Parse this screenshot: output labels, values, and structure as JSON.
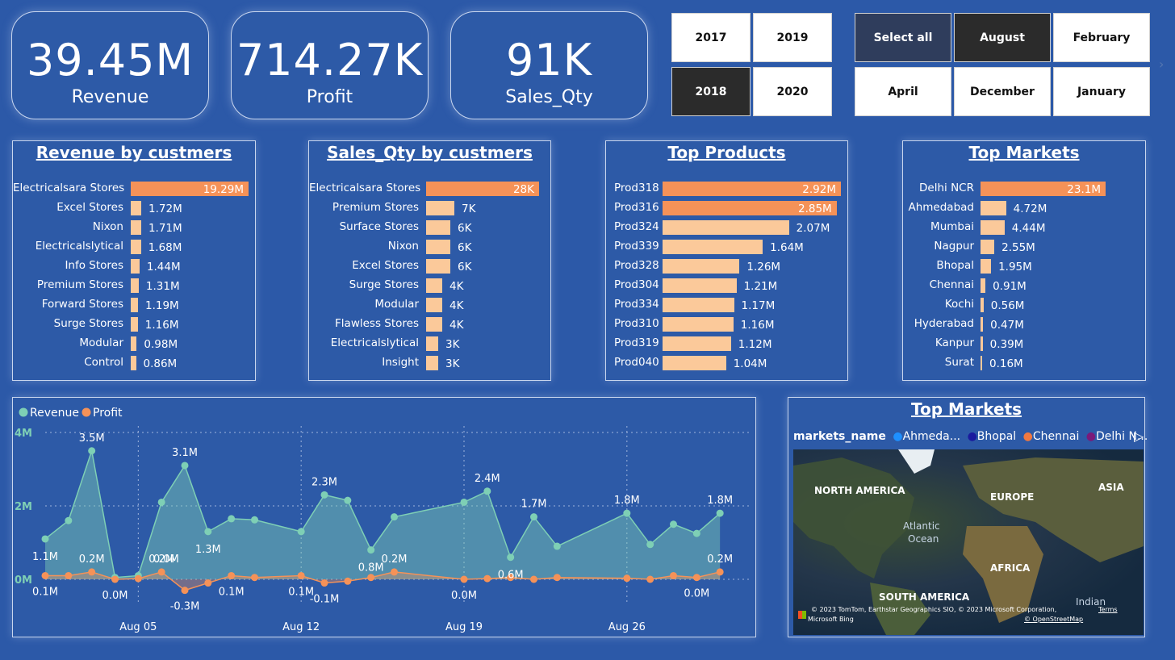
{
  "kpis": [
    {
      "value": "39.45M",
      "label": "Revenue"
    },
    {
      "value": "714.27K",
      "label": "Profit"
    },
    {
      "value": "91K",
      "label": "Sales_Qty"
    }
  ],
  "years": [
    "2017",
    "2019",
    "2018",
    "2020"
  ],
  "months": [
    "Select all",
    "August",
    "February",
    "April",
    "December",
    "January"
  ],
  "panels": {
    "revenue_by_customers": {
      "title": "Revenue by custmers",
      "rows": [
        {
          "label": "Electricalsara Stores",
          "value": 19.29,
          "text": "19.29M"
        },
        {
          "label": "Excel Stores",
          "value": 1.72,
          "text": "1.72M"
        },
        {
          "label": "Nixon",
          "value": 1.71,
          "text": "1.71M"
        },
        {
          "label": "Electricalslytical",
          "value": 1.68,
          "text": "1.68M"
        },
        {
          "label": "Info Stores",
          "value": 1.44,
          "text": "1.44M"
        },
        {
          "label": "Premium Stores",
          "value": 1.31,
          "text": "1.31M"
        },
        {
          "label": "Forward Stores",
          "value": 1.19,
          "text": "1.19M"
        },
        {
          "label": "Surge Stores",
          "value": 1.16,
          "text": "1.16M"
        },
        {
          "label": "Modular",
          "value": 0.98,
          "text": "0.98M"
        },
        {
          "label": "Control",
          "value": 0.86,
          "text": "0.86M"
        }
      ]
    },
    "sales_qty_by_customers": {
      "title": "Sales_Qty by custmers",
      "rows": [
        {
          "label": "Electricalsara Stores",
          "value": 28,
          "text": "28K"
        },
        {
          "label": "Premium Stores",
          "value": 7,
          "text": "7K"
        },
        {
          "label": "Surface Stores",
          "value": 6,
          "text": "6K"
        },
        {
          "label": "Nixon",
          "value": 6,
          "text": "6K"
        },
        {
          "label": "Excel Stores",
          "value": 6,
          "text": "6K"
        },
        {
          "label": "Surge Stores",
          "value": 4,
          "text": "4K"
        },
        {
          "label": "Modular",
          "value": 4,
          "text": "4K"
        },
        {
          "label": "Flawless Stores",
          "value": 4,
          "text": "4K"
        },
        {
          "label": "Electricalslytical",
          "value": 3,
          "text": "3K"
        },
        {
          "label": "Insight",
          "value": 3,
          "text": "3K"
        }
      ]
    },
    "top_products": {
      "title": "Top Products",
      "rows": [
        {
          "label": "Prod318",
          "value": 2.92,
          "text": "2.92M"
        },
        {
          "label": "Prod316",
          "value": 2.85,
          "text": "2.85M"
        },
        {
          "label": "Prod324",
          "value": 2.07,
          "text": "2.07M"
        },
        {
          "label": "Prod339",
          "value": 1.64,
          "text": "1.64M"
        },
        {
          "label": "Prod328",
          "value": 1.26,
          "text": "1.26M"
        },
        {
          "label": "Prod304",
          "value": 1.21,
          "text": "1.21M"
        },
        {
          "label": "Prod334",
          "value": 1.17,
          "text": "1.17M"
        },
        {
          "label": "Prod310",
          "value": 1.16,
          "text": "1.16M"
        },
        {
          "label": "Prod319",
          "value": 1.12,
          "text": "1.12M"
        },
        {
          "label": "Prod040",
          "value": 1.04,
          "text": "1.04M"
        }
      ]
    },
    "top_markets": {
      "title": "Top Markets",
      "rows": [
        {
          "label": "Delhi NCR",
          "value": 23.1,
          "text": "23.1M"
        },
        {
          "label": "Ahmedabad",
          "value": 4.72,
          "text": "4.72M"
        },
        {
          "label": "Mumbai",
          "value": 4.44,
          "text": "4.44M"
        },
        {
          "label": "Nagpur",
          "value": 2.55,
          "text": "2.55M"
        },
        {
          "label": "Bhopal",
          "value": 1.95,
          "text": "1.95M"
        },
        {
          "label": "Chennai",
          "value": 0.91,
          "text": "0.91M"
        },
        {
          "label": "Kochi",
          "value": 0.56,
          "text": "0.56M"
        },
        {
          "label": "Hyderabad",
          "value": 0.47,
          "text": "0.47M"
        },
        {
          "label": "Kanpur",
          "value": 0.39,
          "text": "0.39M"
        },
        {
          "label": "Surat",
          "value": 0.16,
          "text": "0.16M"
        }
      ]
    }
  },
  "colors": {
    "bar_top": "#f59258",
    "bar_other": "#fbc99a",
    "revenue": "#7ecfb5",
    "profit": "#f59258",
    "background": "#2c59a8"
  },
  "chart_data": {
    "type": "area",
    "legend": [
      "Revenue",
      "Profit"
    ],
    "legend_position": "top-left",
    "yticks": [
      "0M",
      "2M",
      "4M"
    ],
    "ylim": [
      0,
      4
    ],
    "xlim": [
      1,
      31
    ],
    "x_tick_labels": [
      {
        "x": 5,
        "label": "Aug 05"
      },
      {
        "x": 12,
        "label": "Aug 12"
      },
      {
        "x": 19,
        "label": "Aug 19"
      },
      {
        "x": 26,
        "label": "Aug 26"
      }
    ],
    "series": [
      {
        "name": "Revenue",
        "x": [
          1,
          2,
          3,
          4,
          5,
          6,
          7,
          8,
          9,
          10,
          12,
          13,
          14,
          15,
          16,
          19,
          20,
          21,
          22,
          23,
          26,
          27,
          28,
          29,
          30
        ],
        "values": [
          1.1,
          1.6,
          3.5,
          0.05,
          0.1,
          2.1,
          3.1,
          1.3,
          1.65,
          1.62,
          1.3,
          2.3,
          2.15,
          0.8,
          1.7,
          2.1,
          2.4,
          0.6,
          1.7,
          0.9,
          1.8,
          0.95,
          1.5,
          1.25,
          1.8
        ]
      },
      {
        "name": "Profit",
        "x": [
          1,
          2,
          3,
          4,
          5,
          6,
          7,
          8,
          9,
          10,
          12,
          13,
          14,
          15,
          16,
          19,
          20,
          21,
          22,
          23,
          26,
          27,
          28,
          29,
          30
        ],
        "values": [
          0.1,
          0.1,
          0.2,
          0.0,
          0.02,
          0.2,
          -0.3,
          -0.1,
          0.1,
          0.05,
          0.1,
          -0.1,
          -0.05,
          0.05,
          0.2,
          0.0,
          0.02,
          0.05,
          0.0,
          0.05,
          0.03,
          0.0,
          0.1,
          0.05,
          0.2
        ]
      }
    ],
    "point_labels": [
      {
        "series": "Revenue",
        "x": 1,
        "text": "1.1M"
      },
      {
        "series": "Revenue",
        "x": 3,
        "text": "3.5M"
      },
      {
        "series": "Revenue",
        "x": 7,
        "text": "3.1M"
      },
      {
        "series": "Revenue",
        "x": 8,
        "text": "1.3M"
      },
      {
        "series": "Revenue",
        "x": 13,
        "text": "2.3M"
      },
      {
        "series": "Revenue",
        "x": 15,
        "text": "0.8M"
      },
      {
        "series": "Revenue",
        "x": 20,
        "text": "2.4M"
      },
      {
        "series": "Revenue",
        "x": 21,
        "text": "0.6M"
      },
      {
        "series": "Revenue",
        "x": 22,
        "text": "1.7M"
      },
      {
        "series": "Revenue",
        "x": 26,
        "text": "1.8M"
      },
      {
        "series": "Revenue",
        "x": 30,
        "text": "1.8M"
      },
      {
        "series": "Profit",
        "x": 1,
        "text": "0.1M"
      },
      {
        "series": "Profit",
        "x": 3,
        "text": "0.2M"
      },
      {
        "series": "Profit",
        "x": 4,
        "text": "0.0M"
      },
      {
        "series": "Profit",
        "x": 6,
        "text": "0.2M"
      },
      {
        "series": "Profit",
        "x": 6.2,
        "text": "0.0M"
      },
      {
        "series": "Profit",
        "x": 7,
        "text": "-0.3M"
      },
      {
        "series": "Profit",
        "x": 9,
        "text": "0.1M"
      },
      {
        "series": "Profit",
        "x": 12,
        "text": "0.1M"
      },
      {
        "series": "Profit",
        "x": 13,
        "text": "-0.1M"
      },
      {
        "series": "Profit",
        "x": 16,
        "text": "0.2M"
      },
      {
        "series": "Profit",
        "x": 19,
        "text": "0.0M"
      },
      {
        "series": "Profit",
        "x": 29,
        "text": "0.0M"
      },
      {
        "series": "Profit",
        "x": 30,
        "text": "0.2M"
      }
    ]
  },
  "map": {
    "title": "Top Markets",
    "legend_title": "markets_name",
    "legend_items": [
      {
        "label": "Ahmeda...",
        "color": "#1e90ff"
      },
      {
        "label": "Bhopal",
        "color": "#1a1a9e"
      },
      {
        "label": "Chennai",
        "color": "#f07840"
      },
      {
        "label": "Delhi N...",
        "color": "#7a1a7a"
      }
    ],
    "labels": [
      "NORTH AMERICA",
      "EUROPE",
      "ASIA",
      "Atlantic",
      "Ocean",
      "AFRICA",
      "SOUTH AMERICA",
      "Indian"
    ],
    "attribution": "© 2023 TomTom, Earthstar Geographics SIO, © 2023 Microsoft Corporation,",
    "terms": "Terms",
    "osm": "© OpenStreetMap",
    "bing": "Microsoft Bing"
  }
}
